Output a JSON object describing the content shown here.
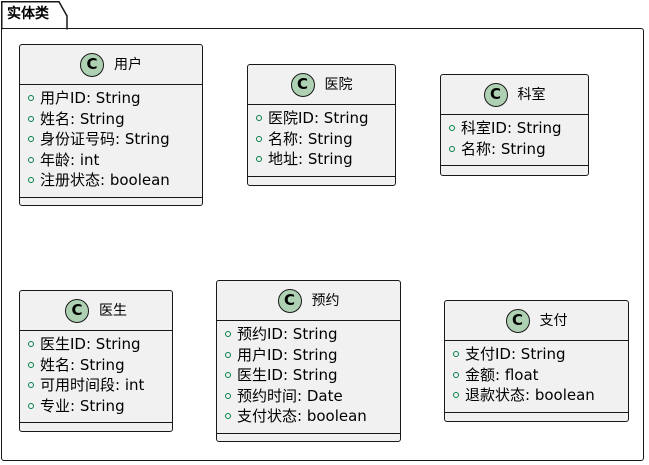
{
  "package": {
    "title": "实体类"
  },
  "classes": [
    {
      "id": "user",
      "badge": "C",
      "name": "用户",
      "fields": [
        "用户ID: String",
        "姓名: String",
        "身份证号码: String",
        "年龄: int",
        "注册状态: boolean"
      ]
    },
    {
      "id": "hospital",
      "badge": "C",
      "name": "医院",
      "fields": [
        "医院ID: String",
        "名称: String",
        "地址: String"
      ]
    },
    {
      "id": "department",
      "badge": "C",
      "name": "科室",
      "fields": [
        "科室ID: String",
        "名称: String"
      ]
    },
    {
      "id": "doctor",
      "badge": "C",
      "name": "医生",
      "fields": [
        "医生ID: String",
        "姓名: String",
        "可用时间段: int",
        "专业: String"
      ]
    },
    {
      "id": "appointment",
      "badge": "C",
      "name": "预约",
      "fields": [
        "预约ID: String",
        "用户ID: String",
        "医生ID: String",
        "预约时间: Date",
        "支付状态: boolean"
      ]
    },
    {
      "id": "payment",
      "badge": "C",
      "name": "支付",
      "fields": [
        "支付ID: String",
        "金额: float",
        "退款状态: boolean"
      ]
    }
  ],
  "colors": {
    "class_background": "#f1f1f1",
    "class_border": "#181818",
    "badge_fill": "#add1b2",
    "field_visibility_marker": "#038048",
    "frame_border": "#181818"
  },
  "icons": {
    "class_badge": "class-stereotype-icon",
    "field_marker": "public-visibility-icon"
  }
}
